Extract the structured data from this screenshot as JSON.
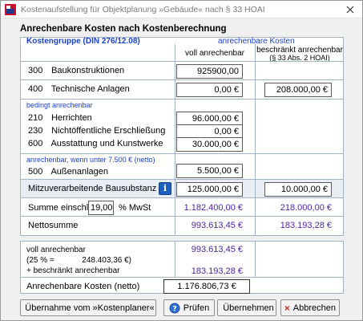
{
  "window": {
    "title": "Kostenaufstellung für Objektplanung »Gebäude« nach § 33 HOAI"
  },
  "heading": "Anrechenbare Kosten nach Kostenberechnung",
  "table": {
    "group_header": "Kostengruppe (DIN 276/12.08)",
    "cost_header": "anrechenbare Kosten",
    "col_full": "voll anrechenbar",
    "col_limited_line1": "beschränkt anrechenbar",
    "col_limited_line2": "(§ 33 Abs. 2 HOAI)",
    "rows": {
      "r300": {
        "code": "300",
        "label": "Baukonstruktionen",
        "full": "925900,00"
      },
      "r400": {
        "code": "400",
        "label": "Technische Anlagen",
        "full": "0,00 €",
        "limited": "208.000,00 €"
      }
    },
    "conditional_header": "bedingt anrechenbar",
    "conditional_rows": [
      {
        "code": "210",
        "label": "Herrichten",
        "full": "96.000,00 €"
      },
      {
        "code": "230",
        "label": "Nichtöffentliche Erschließung",
        "full": "0,00 €"
      },
      {
        "code": "600",
        "label": "Ausstattung und Kunstwerke",
        "full": "30.000,00 €"
      }
    ],
    "under_limit_header": "anrechenbar, wenn unter 7.500 € (netto)",
    "r500": {
      "code": "500",
      "label": "Außenanlagen",
      "full": "5.500,00 €"
    },
    "substance": {
      "label": "Mitzuverarbeitende Bausubstanz",
      "full": "125.000,00 €",
      "limited": "10.000,00 €"
    },
    "gross": {
      "label_prefix": "Summe einschl.",
      "vat_rate": "19,00",
      "label_suffix": "% MwSt",
      "full": "1.182.400,00 €",
      "limited": "218.000,00 €"
    },
    "net": {
      "label": "Nettosumme",
      "full": "993.613,45 €",
      "limited": "183.193,28 €"
    }
  },
  "summary": {
    "full_label": "voll anrechenbar",
    "full_value": "993.613,45 €",
    "share_label": "(25 % =",
    "share_value": "248.403,36 €)",
    "plus_label": "+ beschränkt anrechenbar",
    "plus_value": "183.193,28 €",
    "total_label": "Anrechenbare Kosten (netto)",
    "total_value": "1.176.806,73 €"
  },
  "buttons": {
    "import": "Übernahme vom »Kostenplaner«",
    "check": "Prüfen",
    "accept": "Übernehmen",
    "cancel": "Abbrechen"
  },
  "colors": {
    "header_blue": "#1a3fd4",
    "sum_purple": "#4a1fa8",
    "panel_border": "#9fb3c9"
  }
}
